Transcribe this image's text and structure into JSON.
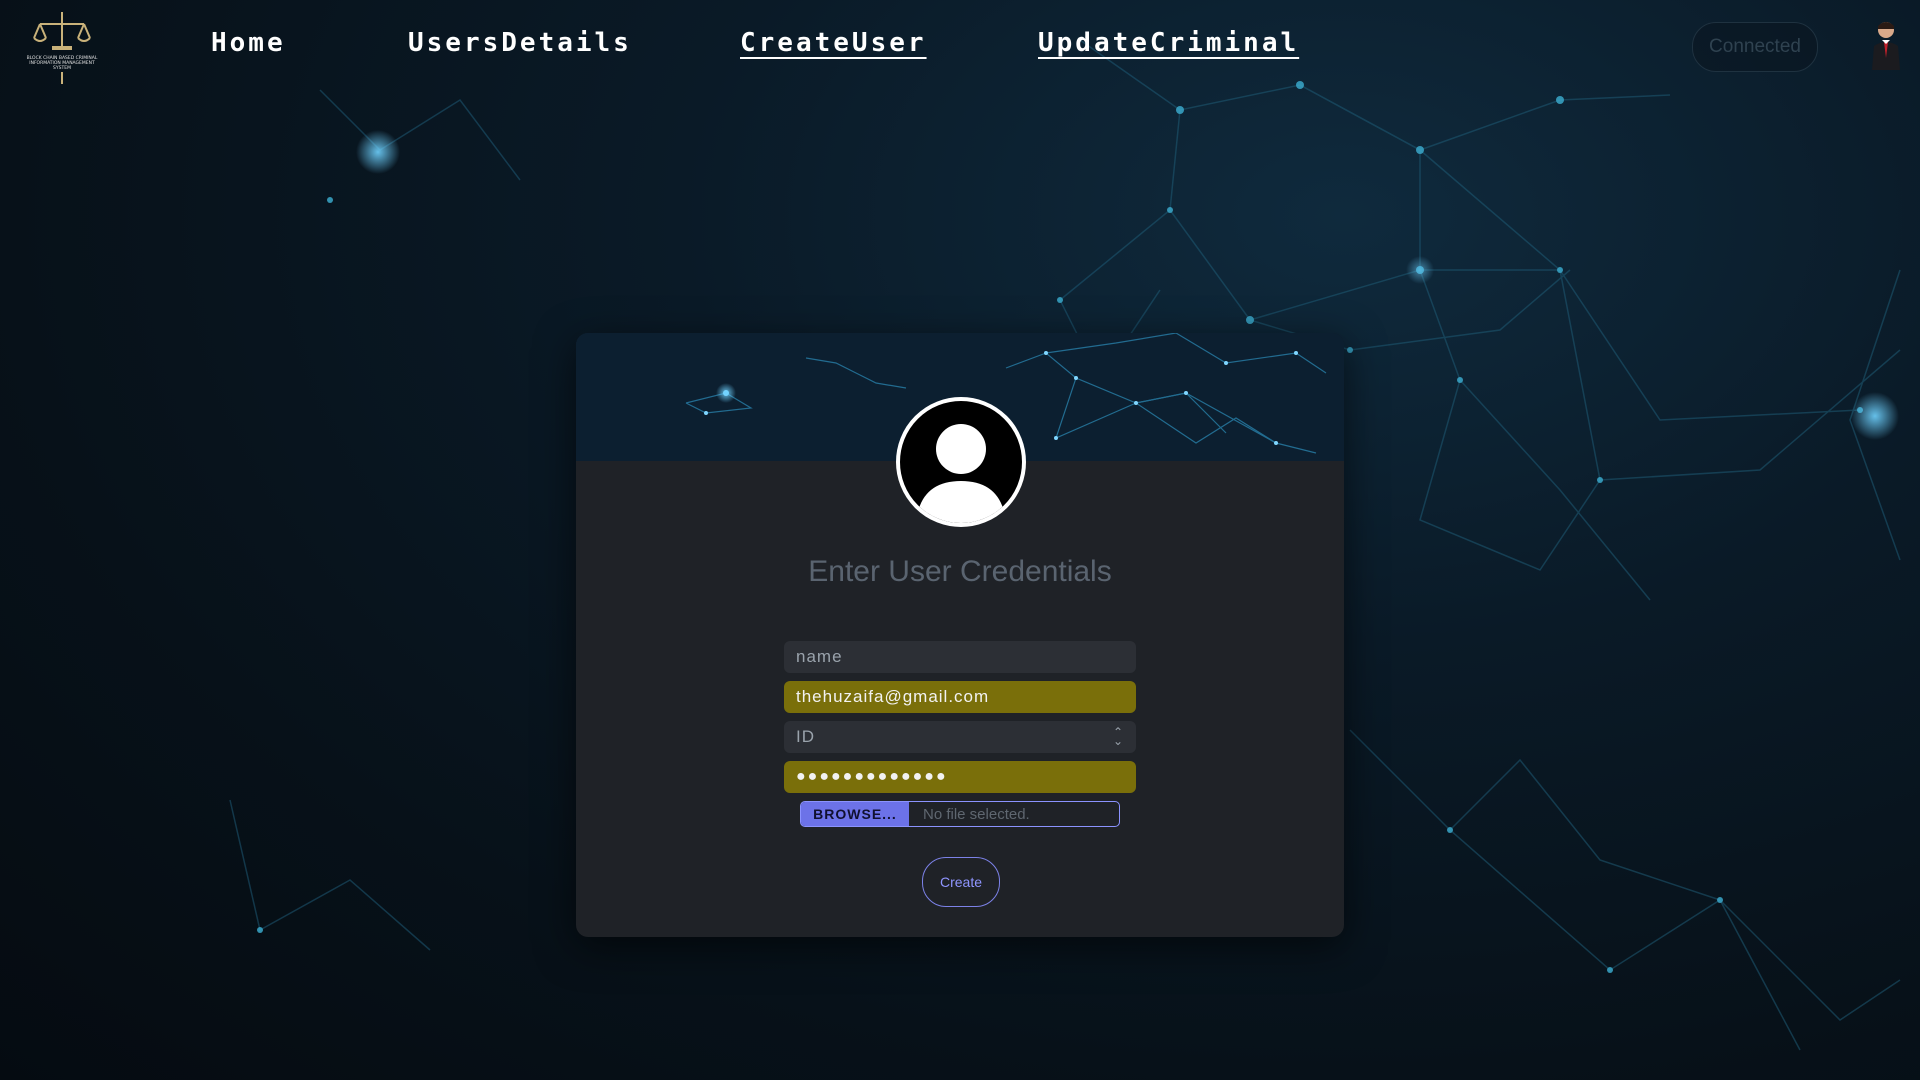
{
  "nav": {
    "links": [
      {
        "label": "Home"
      },
      {
        "label": "UsersDetails"
      },
      {
        "label": "CreateUser"
      },
      {
        "label": "UpdateCriminal"
      }
    ],
    "connected_label": "Connected",
    "logo_text": "BLOCK CHAIN BASED CRIMINAL INFORMATION MANAGEMENT SYSTEM"
  },
  "form": {
    "title": "Enter User Credentials",
    "name_placeholder": "name",
    "email_value": "thehuzaifa@gmail.com",
    "id_placeholder": "ID",
    "password_masked": "●●●●●●●●●●●●●",
    "browse_label": "BROWSE...",
    "file_status": "No file selected.",
    "create_label": "Create"
  },
  "colors": {
    "filled_field": "#7a6f0a",
    "accent": "#8f95ff",
    "card": "#1f2227"
  }
}
